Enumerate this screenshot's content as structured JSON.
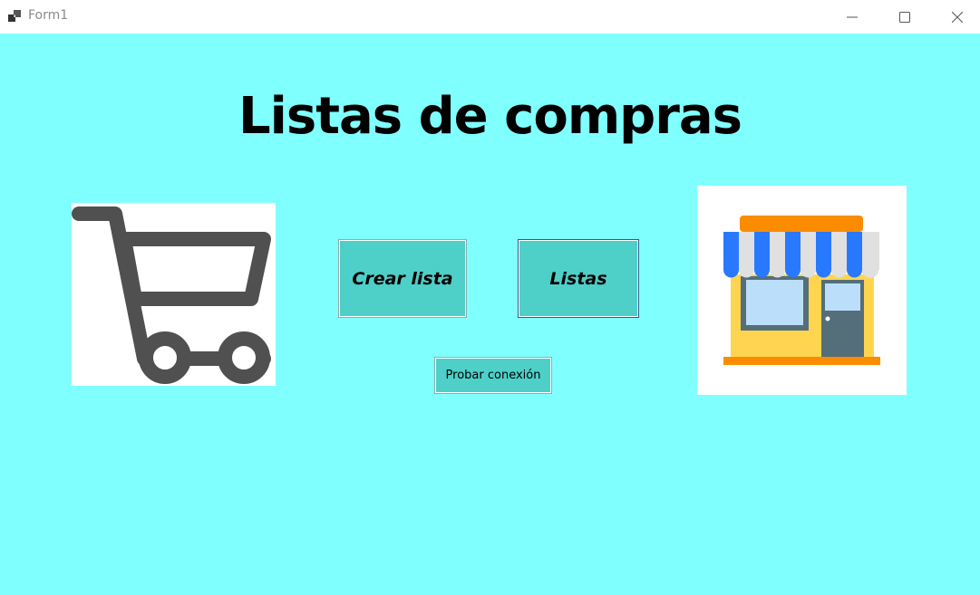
{
  "window": {
    "title": "Form1",
    "background_color": "#80ffff"
  },
  "main": {
    "heading": "Listas de compras",
    "buttons": {
      "create_list": "Crear lista",
      "lists": "Listas",
      "test_connection": "Probar conexión"
    },
    "images": {
      "left": "shopping-cart-icon",
      "right": "store-icon"
    }
  }
}
